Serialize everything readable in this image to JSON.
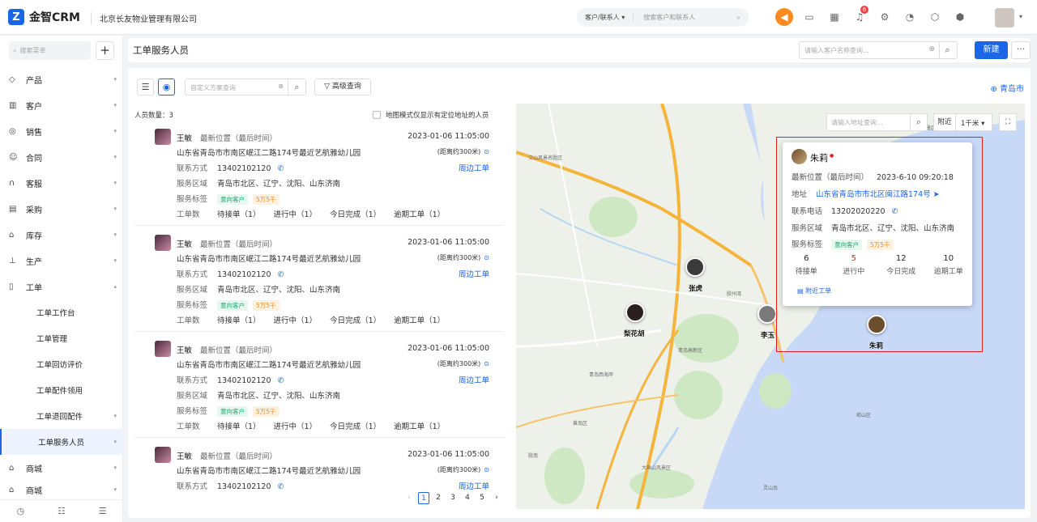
{
  "app": {
    "name": "金智CRM",
    "company": "北京长友物业管理有限公司"
  },
  "topbar": {
    "search_scope": "客户/联系人",
    "search_placeholder": "搜索客户和联系人",
    "notification_count": "6"
  },
  "sidebar": {
    "search_placeholder": "搜索菜单",
    "items": [
      {
        "label": "产品"
      },
      {
        "label": "客户"
      },
      {
        "label": "销售"
      },
      {
        "label": "合同"
      },
      {
        "label": "客服"
      },
      {
        "label": "采购"
      },
      {
        "label": "库存"
      },
      {
        "label": "生产"
      },
      {
        "label": "工单"
      }
    ],
    "sub_items": [
      {
        "label": "工单工作台"
      },
      {
        "label": "工单管理"
      },
      {
        "label": "工单回访评价"
      },
      {
        "label": "工单配件领用"
      },
      {
        "label": "工单退回配件"
      },
      {
        "label": "工单服务人员"
      }
    ],
    "after_items": [
      {
        "label": "商城"
      },
      {
        "label": "商城"
      }
    ]
  },
  "page": {
    "title": "工单服务人员",
    "customer_search_placeholder": "请输入客户名称查询...",
    "new_button": "新建",
    "more_button": "···"
  },
  "toolbar": {
    "filter_placeholder": "自定义方案查询",
    "advanced_query": "高级查询",
    "city": "青岛市"
  },
  "list": {
    "count_text": "人员数量：3",
    "map_mode_text": "地图模式仅显示有定位地址的人员",
    "labels": {
      "latest_position": "最新位置（最后时间）",
      "contact": "联系方式",
      "service_area": "服务区域",
      "service_tags": "服务标签",
      "ticket_count": "工单数",
      "nearby_tickets": "周边工单"
    },
    "persons": [
      {
        "name": "王敏",
        "time": "2023-01-06 11:05:00",
        "address": "山东省青岛市市南区岷江二路174号最近艺航雅幼儿园",
        "distance": "(距离约300米)",
        "phone": "13402102120",
        "area": "青岛市北区、辽宁、沈阳、山东济南",
        "tag1": "意向客户",
        "tag2": "5万5千",
        "pending": "待接单（1）",
        "in_progress": "进行中（1）",
        "done_today": "今日完成（1）",
        "overdue": "逾期工单（1）"
      },
      {
        "name": "王敏",
        "time": "2023-01-06 11:05:00",
        "address": "山东省青岛市市南区岷江二路174号最近艺航雅幼儿园",
        "distance": "(距离约300米)",
        "phone": "13402102120",
        "area": "青岛市北区、辽宁、沈阳、山东济南",
        "tag1": "意向客户",
        "tag2": "5万5千",
        "pending": "待接单（1）",
        "in_progress": "进行中（1）",
        "done_today": "今日完成（1）",
        "overdue": "逾期工单（1）"
      },
      {
        "name": "王敏",
        "time": "2023-01-06 11:05:00",
        "address": "山东省青岛市市南区岷江二路174号最近艺航雅幼儿园",
        "distance": "(距离约300米)",
        "phone": "13402102120",
        "area": "青岛市北区、辽宁、沈阳、山东济南",
        "tag1": "意向客户",
        "tag2": "5万5千",
        "pending": "待接单（1）",
        "in_progress": "进行中（1）",
        "done_today": "今日完成（1）",
        "overdue": "逾期工单（1）"
      },
      {
        "name": "王敏",
        "time": "2023-01-06 11:05:00",
        "address": "山东省青岛市市南区岷江二路174号最近艺航雅幼儿园",
        "distance": "(距离约300米)",
        "phone": "13402102120"
      }
    ],
    "pagination": [
      "1",
      "2",
      "3",
      "4",
      "5"
    ]
  },
  "map": {
    "address_search_placeholder": "请输入地址查询...",
    "nearby_label": "附近",
    "range": "1千米",
    "markers": [
      {
        "name": "张虎"
      },
      {
        "name": "梨花胡"
      },
      {
        "name": "李玉"
      },
      {
        "name": "朱莉"
      }
    ],
    "labels": [
      "艾山风景名胜区",
      "青岛高新区",
      "胶州湾",
      "崂山区",
      "即墨区",
      "青岛西海岸",
      "黄岛区",
      "大珠山风景区",
      "灵山岛",
      "胶南"
    ],
    "popup": {
      "name": "朱莉",
      "latest_position_label": "最新位置（最后时间）",
      "latest_time": "2023-6-10 09:20:18",
      "address_label": "地址",
      "address": "山东省青岛市市北区闽江路174号",
      "phone_label": "联系电话",
      "phone": "13202020220",
      "area_label": "服务区域",
      "area": "青岛市北区、辽宁、沈阳、山东济南",
      "tags_label": "服务标签",
      "tag1": "意向客户",
      "tag2": "5万5千",
      "stats": [
        {
          "value": "6",
          "label": "待接单"
        },
        {
          "value": "5",
          "label": "进行中"
        },
        {
          "value": "12",
          "label": "今日完成"
        },
        {
          "value": "10",
          "label": "逾期工单"
        }
      ],
      "nearby_tickets": "附近工单"
    }
  }
}
